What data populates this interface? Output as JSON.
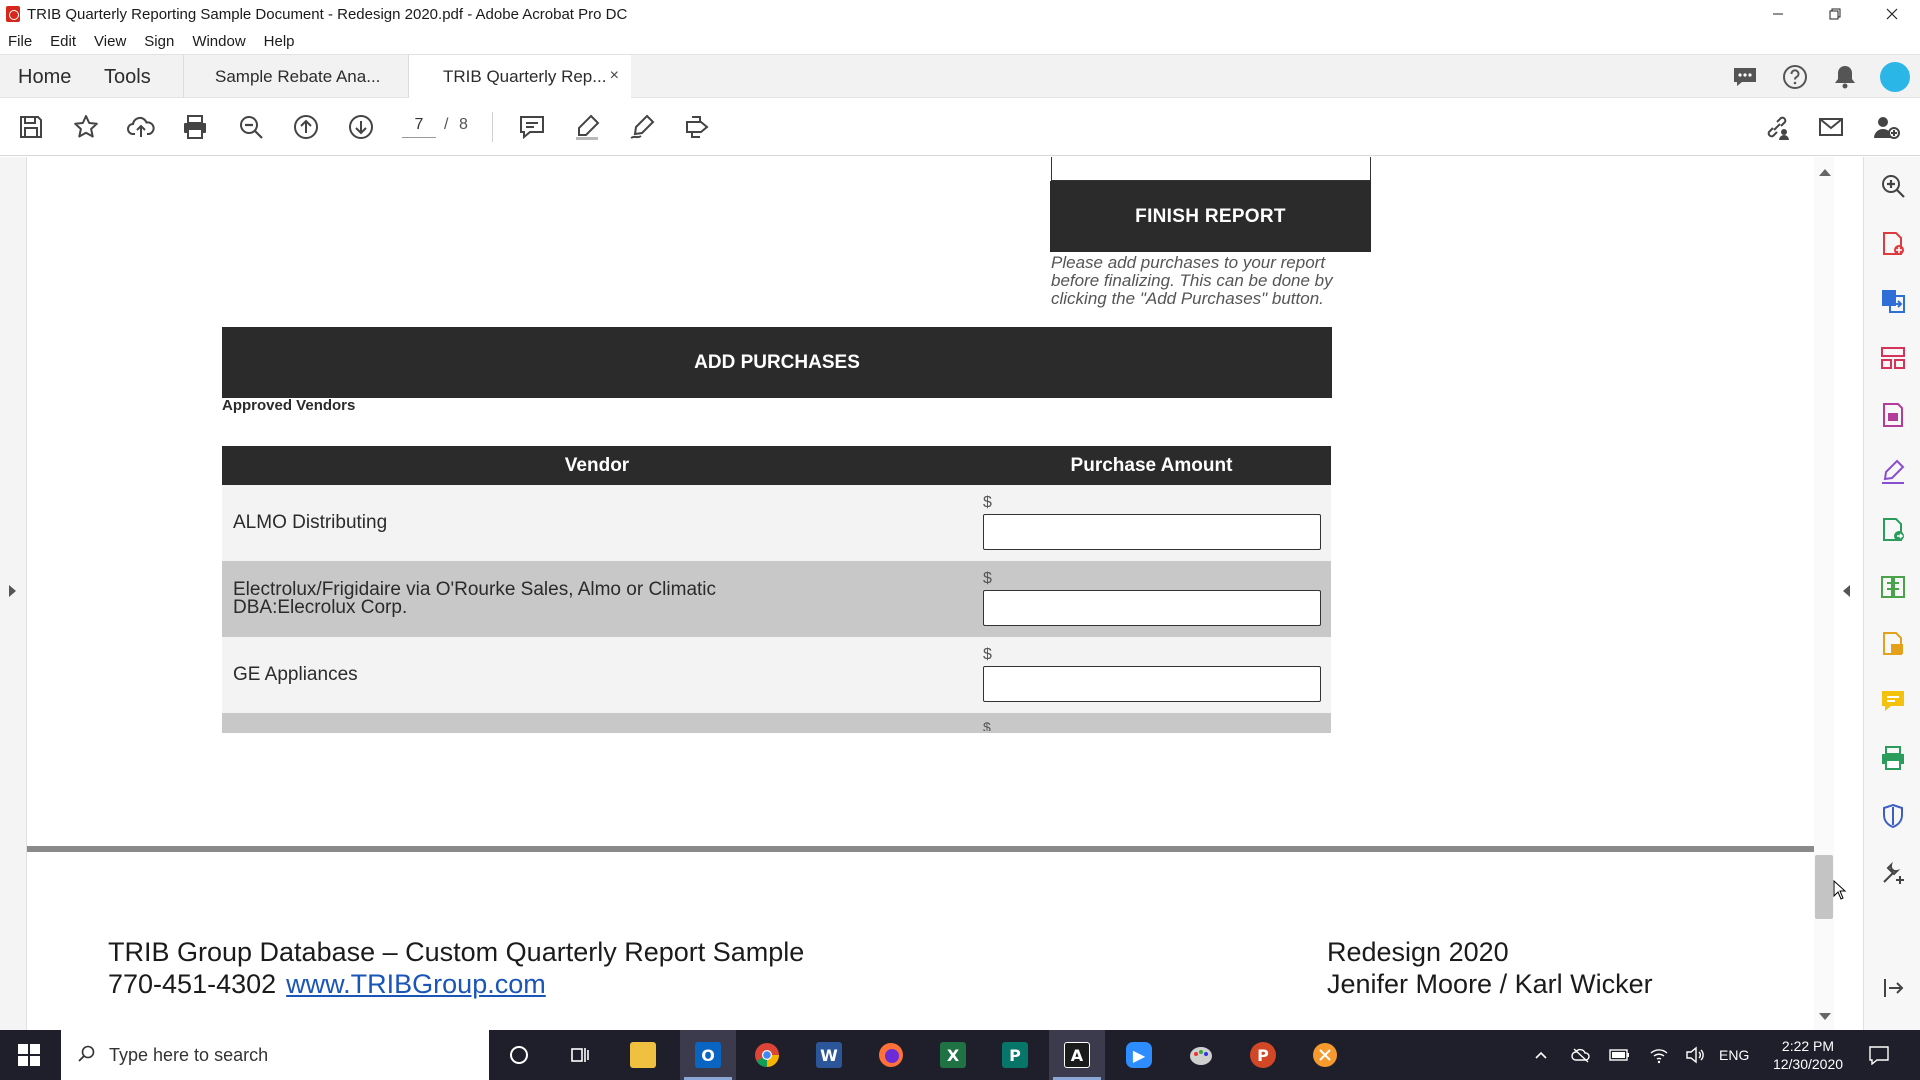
{
  "window": {
    "title": "TRIB Quarterly Reporting Sample Document - Redesign 2020.pdf - Adobe Acrobat Pro DC",
    "controls": [
      "minimize",
      "restore",
      "close"
    ]
  },
  "menu": {
    "items": [
      "File",
      "Edit",
      "View",
      "Sign",
      "Window",
      "Help"
    ]
  },
  "tabs": {
    "home": "Home",
    "tools": "Tools",
    "documents": [
      {
        "label": "Sample Rebate Ana..."
      },
      {
        "label": "TRIB Quarterly Rep...",
        "active": true
      }
    ],
    "close_glyph": "×"
  },
  "toolbar": {
    "page_current": "7",
    "page_separator": "/",
    "page_total": "8"
  },
  "document": {
    "finish_button": "FINISH REPORT",
    "finish_note": "Please add purchases to your report before finalizing. This can be done by clicking the \"Add Purchases\" button.",
    "add_button": "ADD PURCHASES",
    "approved_label": "Approved Vendors",
    "table": {
      "headers": [
        "Vendor",
        "Purchase Amount"
      ],
      "currency_symbol": "$",
      "rows": [
        {
          "vendor": "ALMO Distributing",
          "amount": ""
        },
        {
          "vendor": "Electrolux/Frigidaire via O'Rourke Sales, Almo or Climatic DBA:Elecrolux Corp.",
          "amount": ""
        },
        {
          "vendor": "GE Appliances",
          "amount": ""
        }
      ]
    },
    "footer": {
      "left_line1": "TRIB Group Database – Custom Quarterly Report Sample",
      "phone": "770-451-4302",
      "website": "www.TRIBGroup.com",
      "right_line1": "Redesign 2020",
      "right_line2": "Jenifer Moore / Karl Wicker"
    }
  },
  "taskbar": {
    "search_placeholder": "Type here to search",
    "language": "ENG",
    "time": "2:22 PM",
    "date": "12/30/2020"
  },
  "colors": {
    "button_dark": "#2b2b2b",
    "row_light": "#f3f3f3",
    "row_dark": "#c8c8c8",
    "link": "#1a55b8",
    "taskbar": "#1f1f2b"
  }
}
